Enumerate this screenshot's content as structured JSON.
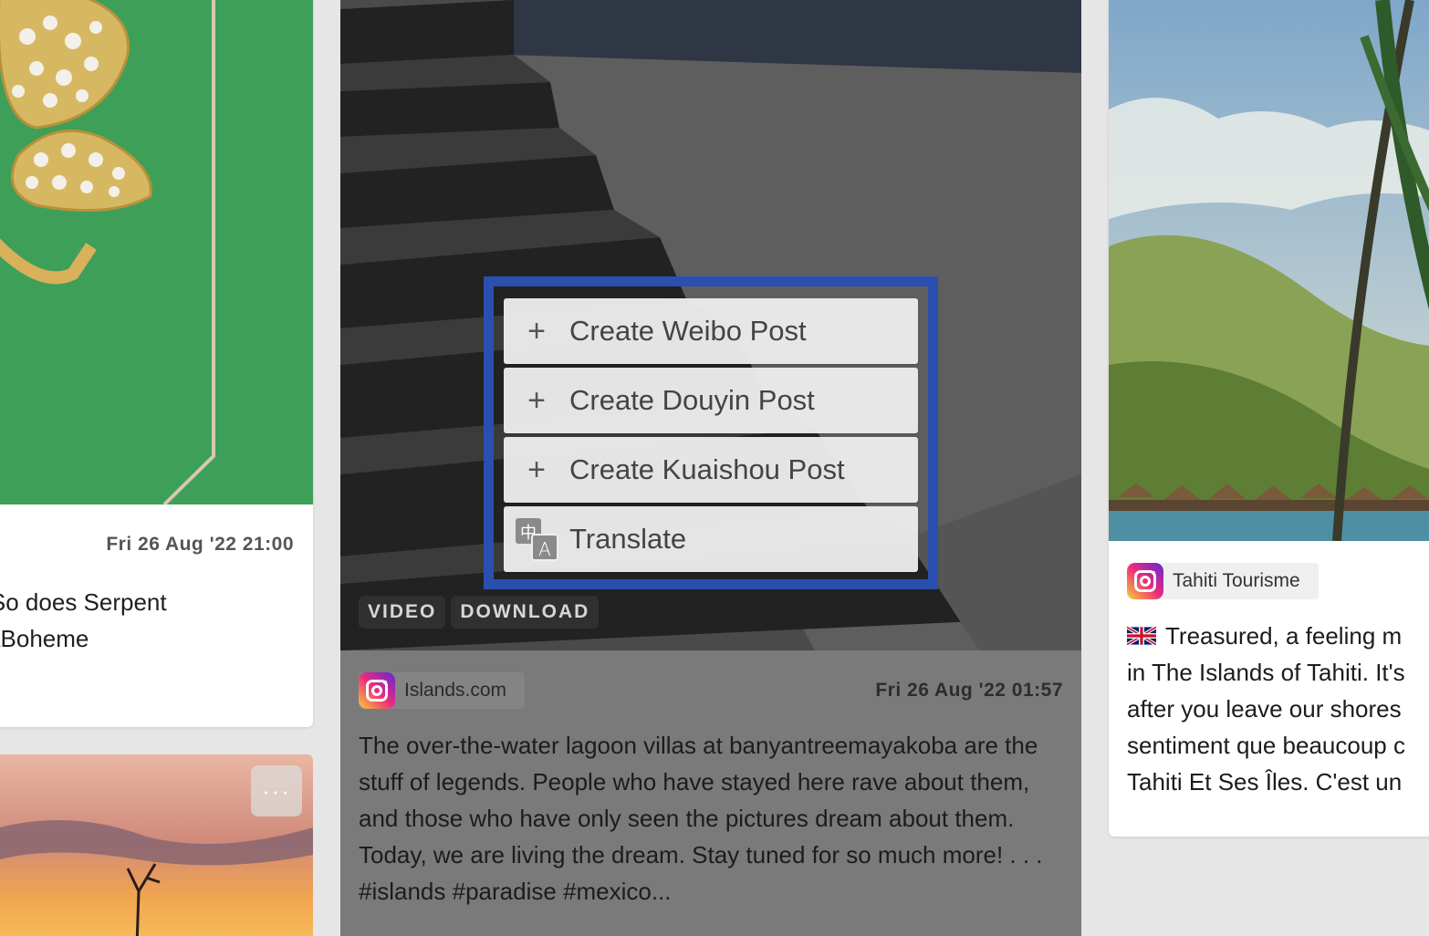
{
  "left_card": {
    "date": "Fri 26 Aug '22 21:00",
    "caption": "ummer. So does Serpent\n#SerpentBoheme"
  },
  "left_card_2": {
    "more_button": "···"
  },
  "center_card": {
    "tags": [
      "VIDEO",
      "DOWNLOAD"
    ],
    "author": "Islands.com",
    "author_icon": "instagram-icon",
    "date": "Fri 26 Aug '22 01:57",
    "caption": "The over-the-water lagoon villas at banyantreemayakoba are the stuff of legends. People who have stayed here rave about them, and those who have only seen the pictures dream about them. Today, we are living the dream. Stay tuned for so much more! . . . #islands #paradise #mexico..."
  },
  "context_menu": {
    "items": [
      {
        "label": "Create Weibo Post",
        "icon": "plus-icon"
      },
      {
        "label": "Create Douyin Post",
        "icon": "plus-icon"
      },
      {
        "label": "Create Kuaishou Post",
        "icon": "plus-icon"
      },
      {
        "label": "Translate",
        "icon": "translate-icon"
      }
    ],
    "highlight_color": "#2b4fb0"
  },
  "right_card": {
    "author": "Tahiti Tourisme",
    "author_icon": "instagram-icon",
    "caption_lines": [
      "Treasured, a feeling m",
      "in The Islands of Tahiti. It's",
      "after you leave our shores",
      "sentiment que beaucoup c",
      "Tahiti Et Ses Îles. C'est un"
    ]
  }
}
